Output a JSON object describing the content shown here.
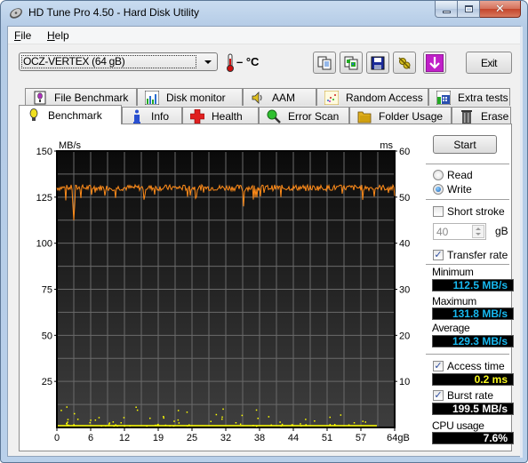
{
  "window": {
    "title": "HD Tune Pro 4.50 - Hard Disk Utility",
    "controls": [
      "minimize",
      "maximize",
      "close"
    ]
  },
  "menu": {
    "items": [
      {
        "label": "File",
        "accel": "F",
        "rest": "ile"
      },
      {
        "label": "Help",
        "accel": "H",
        "rest": "elp"
      }
    ]
  },
  "toolbar": {
    "drive": "OCZ-VERTEX (64 gB)",
    "temperature": "– °C",
    "icons": [
      "copy-text-icon",
      "copy-screenshot-icon",
      "save-icon",
      "options-icon",
      "update-icon"
    ],
    "exit_label": "Exit"
  },
  "tabs": {
    "row1": [
      {
        "label": "File Benchmark",
        "icon": "file-benchmark-icon"
      },
      {
        "label": "Disk monitor",
        "icon": "disk-monitor-icon"
      },
      {
        "label": "AAM",
        "icon": "speaker-icon"
      },
      {
        "label": "Random Access",
        "icon": "random-access-icon"
      },
      {
        "label": "Extra tests",
        "icon": "extra-tests-icon"
      }
    ],
    "row2": [
      {
        "label": "Benchmark",
        "icon": "benchmark-icon",
        "active": true
      },
      {
        "label": "Info",
        "icon": "info-icon"
      },
      {
        "label": "Health",
        "icon": "health-icon"
      },
      {
        "label": "Error Scan",
        "icon": "error-scan-icon"
      },
      {
        "label": "Folder Usage",
        "icon": "folder-icon"
      },
      {
        "label": "Erase",
        "icon": "trash-icon"
      }
    ]
  },
  "side": {
    "start_label": "Start",
    "read_label": "Read",
    "write_label": "Write",
    "mode": "Write",
    "short_stroke_label": "Short stroke",
    "short_stroke_checked": false,
    "short_stroke_value": "40",
    "short_stroke_unit": "gB",
    "transfer_rate_label": "Transfer rate",
    "transfer_rate_checked": true,
    "minimum_label": "Minimum",
    "minimum_value": "112.5 MB/s",
    "maximum_label": "Maximum",
    "maximum_value": "131.8 MB/s",
    "average_label": "Average",
    "average_value": "129.3 MB/s",
    "access_time_label": "Access time",
    "access_time_checked": true,
    "access_time_value": "0.2 ms",
    "burst_rate_label": "Burst rate",
    "burst_rate_checked": true,
    "burst_rate_value": "199.5 MB/s",
    "cpu_label": "CPU usage",
    "cpu_value": "7.6%"
  },
  "colors": {
    "transfer_line": "#ff8c1a",
    "access_dots": "#ffff00",
    "stat_blue": "#17b9f0",
    "stat_yellow": "#fafa1e"
  },
  "chart_data": {
    "type": "line",
    "title": "",
    "xlabel": "gB",
    "ylabel_left": "MB/s",
    "ylabel_right": "ms",
    "xlim": [
      0,
      64
    ],
    "ylim_left": [
      0,
      150
    ],
    "ylim_right": [
      0,
      60
    ],
    "x_ticks": [
      "0",
      "6",
      "12",
      "19",
      "25",
      "32",
      "38",
      "44",
      "51",
      "57",
      "64gB"
    ],
    "x_tick_values": [
      0,
      6.4,
      12.8,
      19.2,
      25.6,
      32,
      38.4,
      44.8,
      51.2,
      57.6,
      64
    ],
    "y_ticks_left": [
      "25",
      "50",
      "75",
      "100",
      "125",
      "150"
    ],
    "y_ticks_right": [
      "10",
      "20",
      "30",
      "40",
      "50",
      "60"
    ],
    "grid": true,
    "series": [
      {
        "name": "Transfer rate",
        "axis": "left",
        "baseline": 129.3,
        "min": 112.5,
        "max": 131.8,
        "dips": [
          {
            "x": 3.2,
            "y": 112.5
          },
          {
            "x": 35.4,
            "y": 120
          }
        ]
      },
      {
        "name": "Access time",
        "axis": "right",
        "baseline": 0.2,
        "scatter_max": 5
      }
    ]
  }
}
